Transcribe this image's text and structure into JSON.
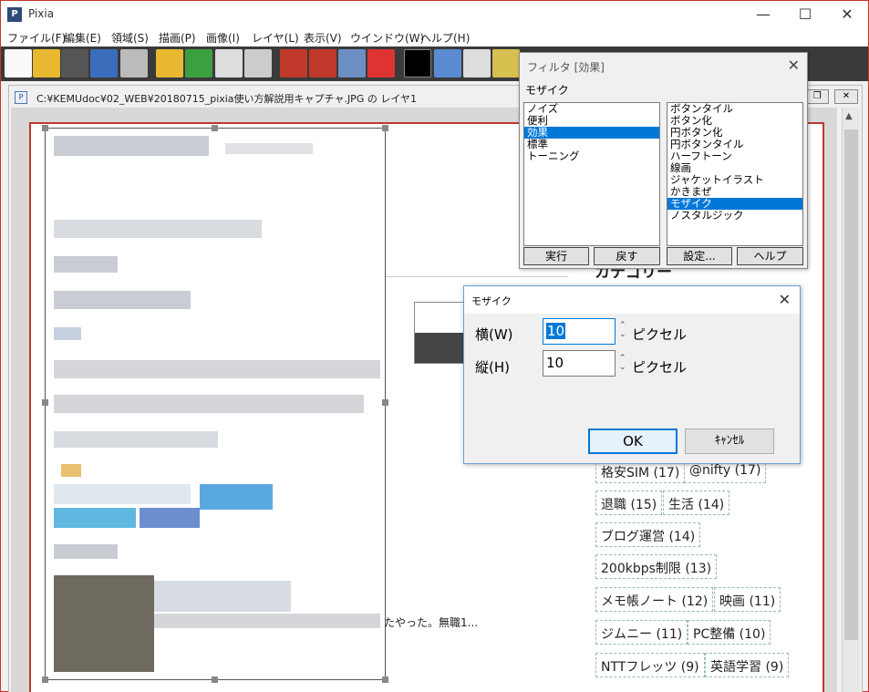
{
  "app": {
    "title": "Pixia",
    "icon_name": "pixia-app-icon"
  },
  "window_controls": {
    "minimize": "—",
    "maximize": "☐",
    "close": "✕"
  },
  "menubar": {
    "items": [
      "ファイル(F)",
      "編集(E)",
      "領域(S)",
      "描画(P)",
      "画像(I)",
      "レイヤ(L)",
      "表示(V)",
      "ウインドウ(W)",
      "ヘルプ(H)"
    ]
  },
  "toolbar": {
    "icons": [
      "new-file-icon",
      "open-folder-icon",
      "camera-icon",
      "save-icon",
      "print-icon",
      "undo-icon",
      "redo-icon",
      "copy-icon",
      "paste-icon",
      "pen-icon",
      "brush-icon",
      "magnifier-icon",
      "text-icon",
      "color-swatch-icon",
      "layer-icon",
      "rotate-icon",
      "palette-icon"
    ]
  },
  "document": {
    "title": "C:¥KEMUdoc¥02_WEB¥20180715_pixia使い方解説用キャプチャ.JPG の レイヤ1",
    "controls": {
      "restore": "❐",
      "close": "✕"
    }
  },
  "page_content": {
    "snippet_text": "たやった。無職1...",
    "category_heading": "カテゴリー",
    "tags": [
      "格安SIM (17)",
      "@nifty (17)",
      "退職 (15)",
      "生活 (14)",
      "ブログ運営 (14)",
      "200kbps制限 (13)",
      "メモ帳ノート (12)",
      "映画 (11)",
      "ジムニー (11)",
      "PC整備 (10)",
      "NTTフレッツ (9)",
      "英語学習 (9)"
    ]
  },
  "filter_dialog": {
    "title": "フィルタ [効果]",
    "subtitle": "モザイク",
    "close": "✕",
    "categories": [
      "ノイズ",
      "便利",
      "効果",
      "標準",
      "トーニング"
    ],
    "selected_category": "効果",
    "effects": [
      "ボタンタイル",
      "ボタン化",
      "円ボタン化",
      "円ボタンタイル",
      "ハーフトーン",
      "線画",
      "ジャケットイラスト",
      "かきまぜ",
      "モザイク",
      "ノスタルジック"
    ],
    "selected_effect": "モザイク",
    "buttons": {
      "execute": "実行",
      "back": "戻す",
      "settings": "設定...",
      "help": "ヘルプ"
    }
  },
  "mosaic_dialog": {
    "title": "モザイク",
    "close": "✕",
    "width_label": "横(W)",
    "width_value": "10",
    "height_label": "縦(H)",
    "height_value": "10",
    "unit": "ピクセル",
    "ok": "OK",
    "cancel": "ｷｬﾝｾﾙ"
  },
  "colors": {
    "selection_blue": "#0078d7",
    "toolbar_bg": "#3a3a3a",
    "canvas_border": "#c0392b"
  }
}
